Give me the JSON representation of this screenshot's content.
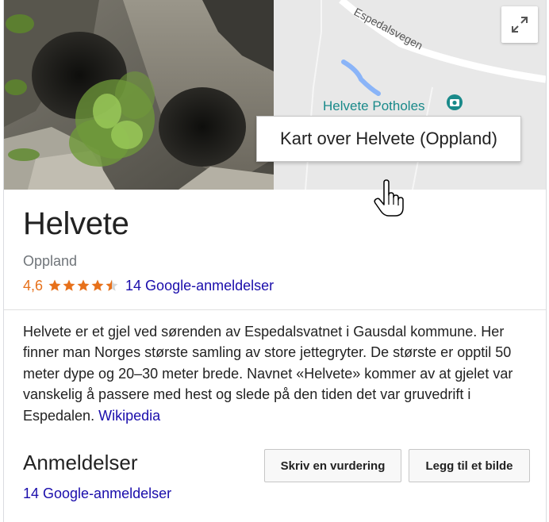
{
  "place": {
    "title": "Helvete",
    "subtitle": "Oppland",
    "rating_value": "4,6",
    "rating_stars": 4.6,
    "reviews_link": "14 Google-anmeldelser"
  },
  "map": {
    "road_label": "Espedalsvegen",
    "poi_label": "Helvete Potholes",
    "tooltip": "Kart over Helvete (Oppland)",
    "expand_icon": "expand-icon"
  },
  "description": {
    "text": "Helvete er et gjel ved sørenden av Espedalsvatnet i Gausdal kommune. Her finner man Norges største samling av store jettegryter. De største er opptil 50 meter dype og 20–30 meter brede. Navnet «Helvete» kommer av at gjelet var vanskelig å passere med hest og slede på den tiden det var gruvedrift i Espedalen.",
    "source_link": "Wikipedia"
  },
  "reviews_section": {
    "title": "Anmeldelser",
    "write_review_label": "Skriv en vurdering",
    "add_photo_label": "Legg til et bilde",
    "reviews_link": "14 Google-anmeldelser"
  },
  "colors": {
    "star": "#e7711b",
    "link": "#1a0dab",
    "road": "#ffffff",
    "water": "#8ab4f8",
    "poi": "#1a8a8a"
  }
}
